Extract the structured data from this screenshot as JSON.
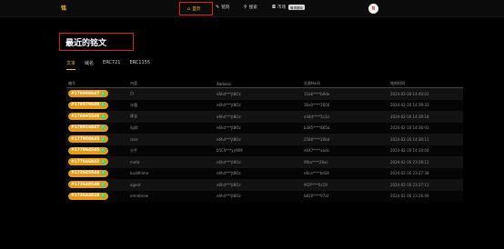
{
  "header": {
    "logo": "铭",
    "nav": {
      "home": "首页",
      "write": "铭刻",
      "search": "搜索",
      "market": "市场",
      "market_badge": "敬请期待"
    },
    "avatar_text": "铭"
  },
  "page_title": "最近的铭文",
  "tabs": [
    "文本",
    "域名",
    "ERC721",
    "ERC1155"
  ],
  "table": {
    "headers": [
      "编号",
      "内容",
      "Address",
      "交易Hash",
      "铭刻时间"
    ],
    "rows": [
      {
        "id": "#178998847",
        "content": "白",
        "address": "e6hd***jt8Oz",
        "hash": "11b6****b9de",
        "time": "2024-02-16 14:40:03"
      },
      {
        "id": "#178979849",
        "content": "冰霜",
        "address": "e6hd***jt8Oz",
        "hash": "36e0****2600",
        "time": "2024-02-16 14:39:33"
      },
      {
        "id": "#178995548",
        "content": "珠宝",
        "address": "e6hd***jt8Oz",
        "hash": "e34d****5c33",
        "time": "2024-02-16 14:39:18"
      },
      {
        "id": "#178916847",
        "content": "light",
        "address": "e6hd***jt8Oz",
        "hash": "b385****865a",
        "time": "2024-02-16 14:36:03"
      },
      {
        "id": "#177900845",
        "content": "rose",
        "address": "e6hd***jt8Oz",
        "hash": "2580****20bd",
        "time": "2024-02-16 14:30:11"
      },
      {
        "id": "#177864545",
        "content": "分手",
        "address": "b5C9***yyWM",
        "hash": "d447****aacb",
        "time": "2024-02-16 14:30:04"
      },
      {
        "id": "#177846842",
        "content": "meta",
        "address": "e6hd***jt8Oz",
        "hash": "9fba****26ac",
        "time": "2024-02-16 23:28:12"
      },
      {
        "id": "#173645544",
        "content": "buddhime",
        "address": "e6hd***jt8Oz",
        "hash": "e6ca****bd34",
        "time": "2024-02-16 23:27:38"
      },
      {
        "id": "#173648548",
        "content": "agent",
        "address": "e6hd***jt8Oz",
        "hash": "9f2f****6c19",
        "time": "2024-02-16 23:27:11"
      },
      {
        "id": "#173644818",
        "content": "emmbrew",
        "address": "e6hd***jt8Oz",
        "hash": "b820****97af",
        "time": "2024-02-16 23:26:49"
      }
    ]
  },
  "colors": {
    "accent": "#f2bf24",
    "pill": "#e89a16",
    "highlight_box": "#e02020",
    "verified": "#3fd17a"
  },
  "icons": {
    "home": "home-icon",
    "write": "pen-icon",
    "search": "search-icon",
    "market": "bag-icon",
    "verified": "check-icon"
  }
}
